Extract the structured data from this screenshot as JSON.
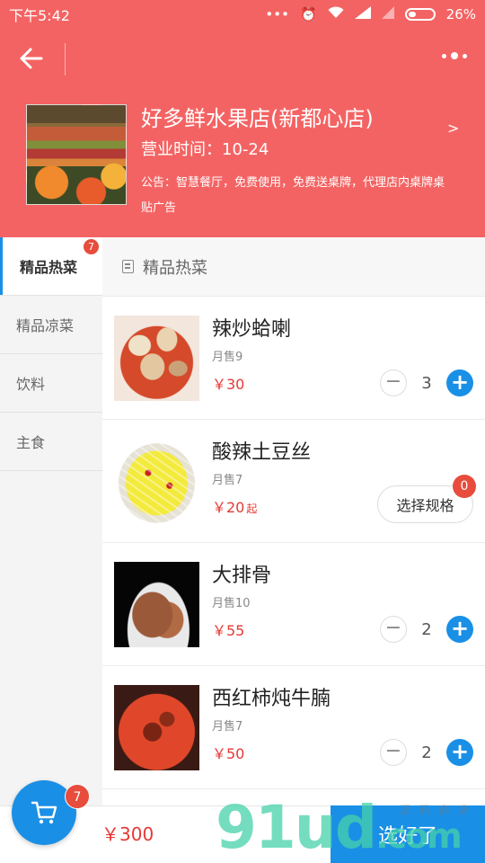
{
  "status_bar": {
    "time": "下午5:42",
    "battery": "26%"
  },
  "store": {
    "name": "好多鲜水果店(新都心店)",
    "hours": "营业时间：10-24",
    "notice": "公告：智慧餐厅，免费使用，免费送桌牌，代理店内桌牌桌贴广告",
    "arrow": ">"
  },
  "sidebar": {
    "items": [
      {
        "label": "精品热菜",
        "badge": "7"
      },
      {
        "label": "精品凉菜"
      },
      {
        "label": "饮料"
      },
      {
        "label": "主食"
      }
    ]
  },
  "section": {
    "title": "精品热菜"
  },
  "dishes": [
    {
      "name": "辣炒蛤喇",
      "sold": "月售9",
      "price": "￥30",
      "qty": "3"
    },
    {
      "name": "酸辣土豆丝",
      "sold": "月售7",
      "price": "￥20",
      "price_suffix": "起",
      "spec_label": "选择规格",
      "spec_badge": "0"
    },
    {
      "name": "大排骨",
      "sold": "月售10",
      "price": "￥55",
      "qty": "2"
    },
    {
      "name": "西红柿炖牛腩",
      "sold": "月售7",
      "price": "￥50",
      "qty": "2"
    }
  ],
  "cart": {
    "badge": "7",
    "total": "￥300",
    "checkout_label": "选好了"
  },
  "watermark": {
    "main": "91ud",
    "suffix": ".com",
    "sub": "源 码 商 店"
  },
  "colors": {
    "header": "#f46363",
    "accent": "#1a8fe6",
    "price": "#e53935",
    "badge": "#e74c3c"
  },
  "icons": [
    "back-arrow-icon",
    "more-dots-icon",
    "menu-list-icon",
    "cart-icon",
    "minus-icon",
    "plus-icon"
  ]
}
